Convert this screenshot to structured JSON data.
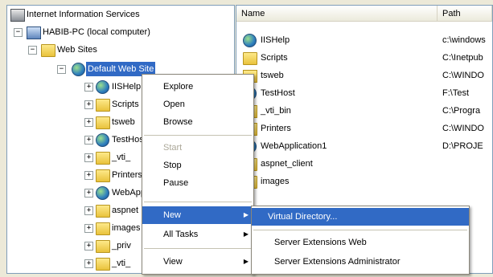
{
  "tree": {
    "root": "Internet Information Services",
    "computer": "HABIB-PC (local computer)",
    "websites": "Web Sites",
    "selected": "Default Web Site",
    "children": [
      "IISHelp",
      "Scripts",
      "tsweb",
      "TestHost",
      "_vti_",
      "Printers",
      "WebApp",
      "aspnet",
      "images",
      "_priv",
      "_vti_"
    ]
  },
  "list": {
    "headers": {
      "name": "Name",
      "path": "Path"
    },
    "rows": [
      {
        "name": "IISHelp",
        "path": "c:\\windows"
      },
      {
        "name": "Scripts",
        "path": "C:\\Inetpub"
      },
      {
        "name": "tsweb",
        "path": "C:\\WINDO"
      },
      {
        "name": "TestHost",
        "path": "F:\\Test"
      },
      {
        "name": "_vti_bin",
        "path": "C:\\Progra"
      },
      {
        "name": "Printers",
        "path": "C:\\WINDO"
      },
      {
        "name": "WebApplication1",
        "path": "D:\\PROJE"
      },
      {
        "name": "aspnet_client",
        "path": ""
      },
      {
        "name": "images",
        "path": ""
      }
    ]
  },
  "context_menu": {
    "items": [
      {
        "label": "Explore",
        "disabled": false
      },
      {
        "label": "Open",
        "disabled": false
      },
      {
        "label": "Browse",
        "disabled": false
      },
      {
        "label": "Start",
        "disabled": true
      },
      {
        "label": "Stop",
        "disabled": false
      },
      {
        "label": "Pause",
        "disabled": false
      },
      {
        "label": "New",
        "disabled": false,
        "highlighted": true
      },
      {
        "label": "All Tasks",
        "disabled": false
      },
      {
        "label": "View",
        "disabled": false
      }
    ]
  },
  "submenu": {
    "items": [
      {
        "label": "Virtual Directory...",
        "highlighted": true
      },
      {
        "label": "Server Extensions Web"
      },
      {
        "label": "Server Extensions Administrator"
      }
    ]
  },
  "colors": {
    "selection": "#316ac5",
    "window": "#ece9d8"
  }
}
